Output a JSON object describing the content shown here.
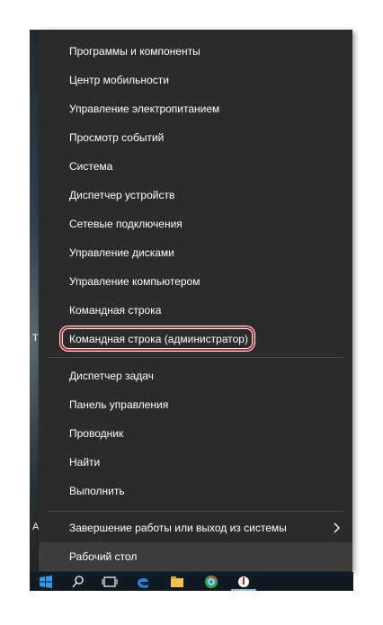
{
  "menu": {
    "group1": [
      {
        "label": "Программы и компоненты"
      },
      {
        "label": "Центр мобильности"
      },
      {
        "label": "Управление электропитанием"
      },
      {
        "label": "Просмотр событий"
      },
      {
        "label": "Система"
      },
      {
        "label": "Диспетчер устройств"
      },
      {
        "label": "Сетевые подключения"
      },
      {
        "label": "Управление дисками"
      },
      {
        "label": "Управление компьютером"
      },
      {
        "label": "Командная строка"
      },
      {
        "label": "Командная строка (администратор)"
      }
    ],
    "group2": [
      {
        "label": "Диспетчер задач"
      },
      {
        "label": "Панель управления"
      },
      {
        "label": "Проводник"
      },
      {
        "label": "Найти"
      },
      {
        "label": "Выполнить"
      }
    ],
    "shutdown": {
      "label": "Завершение работы или выход из системы"
    },
    "desktop": {
      "label": "Рабочий стол"
    }
  },
  "colors": {
    "menu_bg": "#2b2b2b",
    "hover_bg": "#3c3c3c",
    "highlight_ring": "#d4202a",
    "text": "#ffffff"
  },
  "icons": [
    "windows-icon",
    "search-icon",
    "task-view-icon",
    "edge-icon",
    "explorer-icon",
    "chrome-icon",
    "app-icon"
  ],
  "desktop_letters": {
    "t": "T",
    "a": "A"
  }
}
